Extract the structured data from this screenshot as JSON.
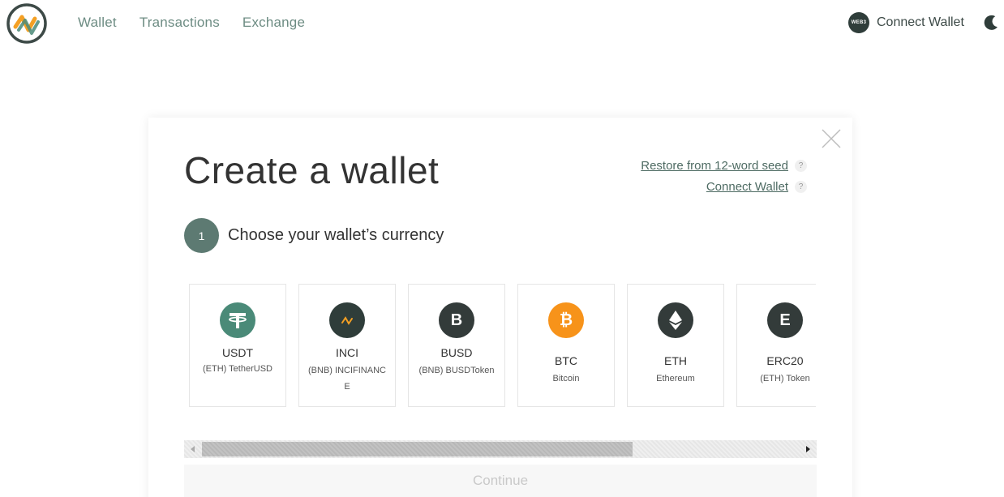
{
  "nav": {
    "items": [
      {
        "label": "Wallet"
      },
      {
        "label": "Transactions"
      },
      {
        "label": "Exchange"
      }
    ]
  },
  "header": {
    "connect_label": "Connect Wallet",
    "web3_badge": "WEB3",
    "logo_icon": "logo-icon",
    "theme_icon": "moon-icon"
  },
  "modal": {
    "title": "Create a wallet",
    "restore_link": "Restore from 12-word seed",
    "connect_link": "Connect Wallet",
    "help_glyph": "?",
    "step_number": "1",
    "step_label": "Choose your wallet’s currency",
    "continue_label": "Continue",
    "currencies": [
      {
        "symbol": "USDT",
        "name": "(ETH) TetherUSD",
        "color": "#4a8a78",
        "glyph": "T"
      },
      {
        "symbol": "INCI",
        "name": "(BNB) INCIFINANCE",
        "color": "#2f3d3a",
        "glyph": ""
      },
      {
        "symbol": "BUSD",
        "name": "(BNB) BUSDToken",
        "color": "#333b3a",
        "glyph": "B"
      },
      {
        "symbol": "BTC",
        "name": "Bitcoin",
        "color": "#f7931a",
        "glyph": "₿"
      },
      {
        "symbol": "ETH",
        "name": "Ethereum",
        "color": "#333b3a",
        "glyph": ""
      },
      {
        "symbol": "ERC20",
        "name": "(ETH) Token",
        "color": "#333b3a",
        "glyph": "E"
      }
    ]
  },
  "colors": {
    "accent": "#5d7a72",
    "nav_text": "#6d8c83",
    "link": "#4e6b63"
  }
}
